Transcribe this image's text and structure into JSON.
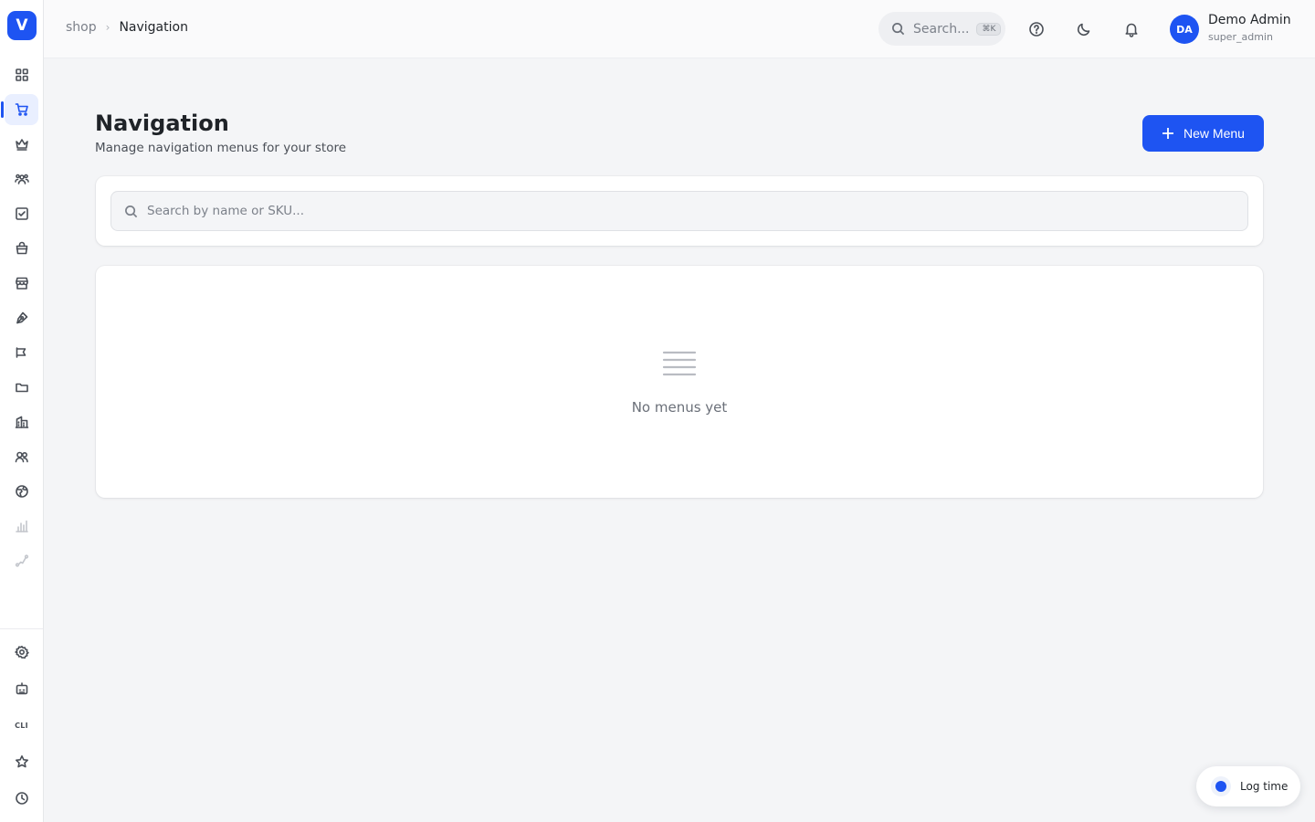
{
  "app": {
    "logo_letter": "V",
    "accent_color": "#1e54f2"
  },
  "sidebar": {
    "items": [
      {
        "icon": "dashboard-grid-icon"
      },
      {
        "icon": "shopping-cart-icon",
        "active": true
      },
      {
        "icon": "crown-icon"
      },
      {
        "icon": "users-group-icon"
      },
      {
        "icon": "checkbox-icon"
      },
      {
        "icon": "shopping-bag-icon"
      },
      {
        "icon": "storefront-icon"
      },
      {
        "icon": "pen-tool-icon"
      },
      {
        "icon": "megaphone-icon"
      },
      {
        "icon": "folder-icon"
      },
      {
        "icon": "building-icon"
      },
      {
        "icon": "people-icon"
      },
      {
        "icon": "globe-icon"
      },
      {
        "icon": "bar-chart-icon",
        "disabled": true
      },
      {
        "icon": "route-icon",
        "disabled": true
      }
    ],
    "bottom_items": [
      {
        "icon": "settings-gear-icon"
      },
      {
        "icon": "robot-icon"
      },
      {
        "icon": "cli-icon",
        "label": "CLI"
      },
      {
        "icon": "star-icon"
      },
      {
        "icon": "clock-icon"
      }
    ]
  },
  "topbar": {
    "breadcrumb": {
      "root": "shop",
      "current": "Navigation"
    },
    "search": {
      "placeholder": "Search...",
      "shortcut": "⌘K"
    },
    "user": {
      "initials": "DA",
      "name": "Demo Admin",
      "role": "super_admin"
    }
  },
  "main": {
    "title": "Navigation",
    "subtitle": "Manage navigation menus for your store",
    "new_button_label": "New Menu",
    "search_placeholder": "Search by name or SKU...",
    "empty_state_text": "No menus yet"
  },
  "floating": {
    "log_time_label": "Log time"
  }
}
